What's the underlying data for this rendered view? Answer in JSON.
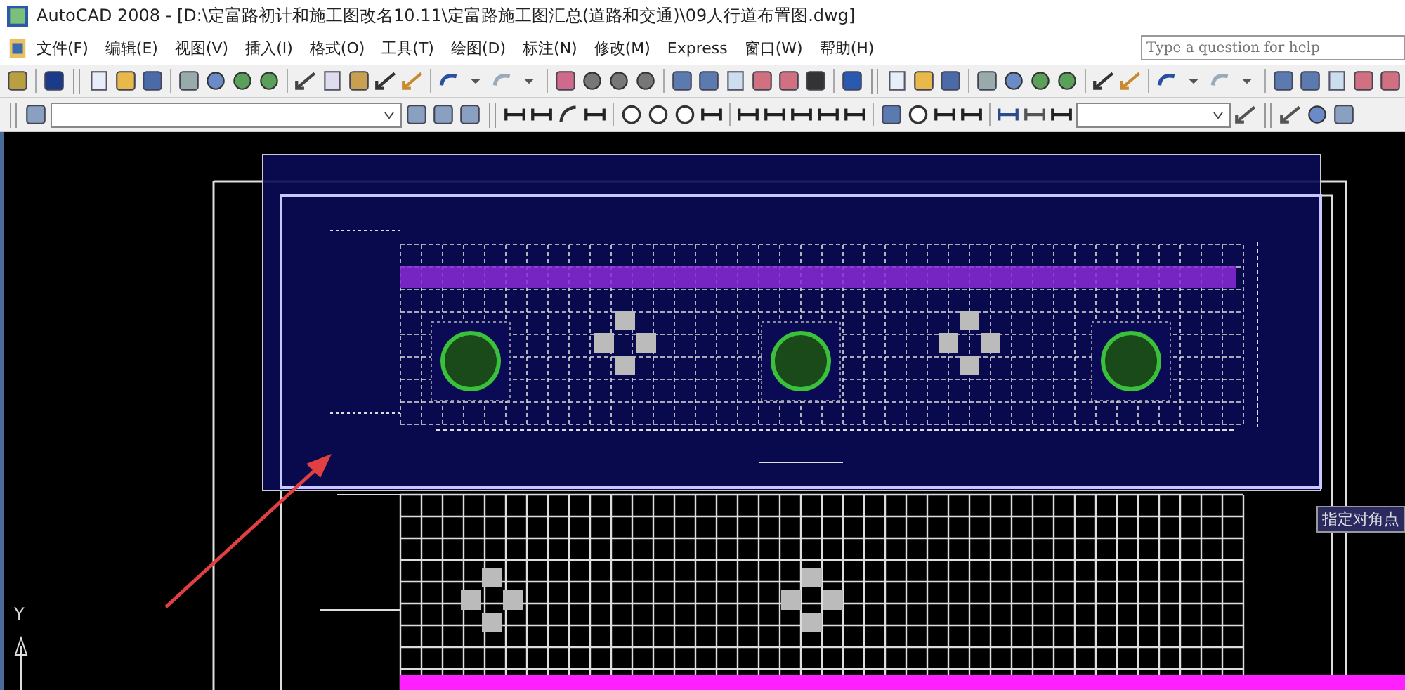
{
  "window": {
    "title": "AutoCAD 2008 - [D:\\定富路初计和施工图改名10.11\\定富路施工图汇总(道路和交通)\\09人行道布置图.dwg]"
  },
  "menu": [
    "文件(F)",
    "编辑(E)",
    "视图(V)",
    "插入(I)",
    "格式(O)",
    "工具(T)",
    "绘图(D)",
    "标注(N)",
    "修改(M)",
    "Express",
    "窗口(W)",
    "帮助(H)"
  ],
  "help_search": {
    "placeholder": "Type a question for help"
  },
  "canvas": {
    "ucs_label": "Y",
    "tooltip": "指定对角点"
  }
}
